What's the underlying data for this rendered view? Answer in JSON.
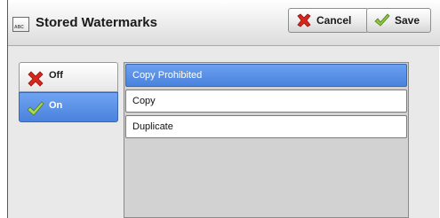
{
  "dialog": {
    "title": "Stored Watermarks",
    "title_icon_text": "ABC",
    "cancel_label": "Cancel",
    "save_label": "Save"
  },
  "toggle": {
    "off_label": "Off",
    "on_label": "On",
    "selected": "On"
  },
  "watermarks": {
    "items": [
      "Copy Prohibited",
      "Copy",
      "Duplicate"
    ],
    "selected": "Copy Prohibited"
  },
  "colors": {
    "selection_blue": "#5a91e8",
    "cancel_red": "#d9261c",
    "save_green": "#8cc63f"
  }
}
